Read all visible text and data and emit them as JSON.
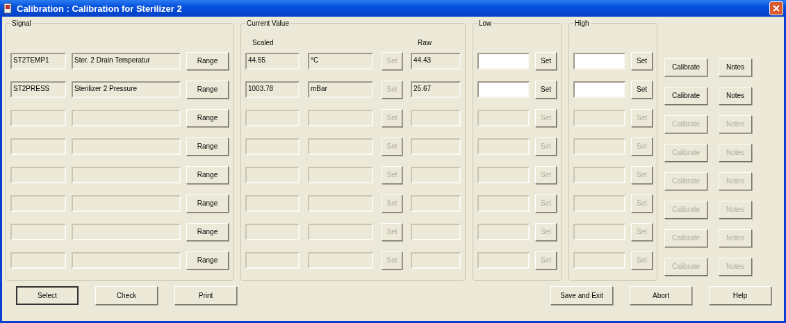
{
  "window": {
    "title": "Calibration : Calibration for Sterilizer 2"
  },
  "groups": {
    "signal": "Signal",
    "current": "Current Value",
    "scaled": "Scaled",
    "raw": "Raw",
    "low": "Low",
    "high": "High"
  },
  "rows": [
    {
      "tag": "ST2TEMP1",
      "description": "Ster. 2 Drain Temperatur",
      "scaled": "44.55",
      "unit": "°C",
      "raw": "44.43",
      "enabled": true,
      "range": "Range",
      "set_value": {
        "label": "Set",
        "disabled": true
      },
      "set_low": "Set",
      "set_high": "Set",
      "calibrate": "Calibrate",
      "notes": "Notes"
    },
    {
      "tag": "ST2PRESS",
      "description": "Sterilizer 2 Pressure",
      "scaled": "1003.78",
      "unit": "mBar",
      "raw": "25.67",
      "enabled": true,
      "range": "Range",
      "set_value": {
        "label": "Set",
        "disabled": true
      },
      "set_low": "Set",
      "set_high": "Set",
      "calibrate": "Calibrate",
      "notes": "Notes"
    },
    {
      "enabled": false,
      "range": "Range",
      "set_value": {
        "label": "Set",
        "disabled": true
      },
      "set_low": "Set",
      "set_high": "Set",
      "calibrate": "Calibrate",
      "notes": "Notes"
    },
    {
      "enabled": false,
      "range": "Range",
      "set_value": {
        "label": "Set",
        "disabled": true
      },
      "set_low": "Set",
      "set_high": "Set",
      "calibrate": "Calibrate",
      "notes": "Notes"
    },
    {
      "enabled": false,
      "range": "Range",
      "set_value": {
        "label": "Set",
        "disabled": true
      },
      "set_low": "Set",
      "set_high": "Set",
      "calibrate": "Calibrate",
      "notes": "Notes"
    },
    {
      "enabled": false,
      "range": "Range",
      "set_value": {
        "label": "Set",
        "disabled": true
      },
      "set_low": "Set",
      "set_high": "Set",
      "calibrate": "Calibrate",
      "notes": "Notes"
    },
    {
      "enabled": false,
      "range": "Range",
      "set_value": {
        "label": "Set",
        "disabled": true
      },
      "set_low": "Set",
      "set_high": "Set",
      "calibrate": "Calibrate",
      "notes": "Notes"
    },
    {
      "enabled": false,
      "range": "Range",
      "set_value": {
        "label": "Set",
        "disabled": true
      },
      "set_low": "Set",
      "set_high": "Set",
      "calibrate": "Calibrate",
      "notes": "Notes"
    }
  ],
  "footer_left": [
    {
      "label": "Select",
      "default": true
    },
    {
      "label": "Check",
      "default": false
    },
    {
      "label": "Print",
      "default": false
    }
  ],
  "footer_right": [
    {
      "label": "Save and Exit",
      "default": false
    },
    {
      "label": "Abort",
      "default": false
    },
    {
      "label": "Help",
      "default": false
    }
  ]
}
